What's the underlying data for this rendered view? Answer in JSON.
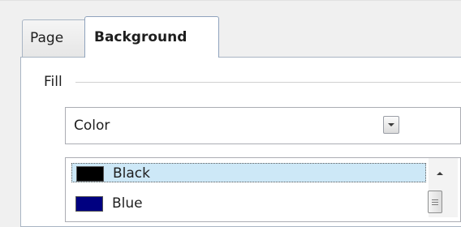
{
  "tabs": [
    {
      "label": "Page",
      "selected": false
    },
    {
      "label": "Background",
      "selected": true
    }
  ],
  "fill_group": {
    "label": "Fill",
    "fill_type": {
      "value": "Color"
    },
    "colors": [
      {
        "name": "Black",
        "swatch": "#000000",
        "selected": true
      },
      {
        "name": "Blue",
        "swatch": "#000080",
        "selected": false
      }
    ]
  },
  "icons": {
    "dropdown": "chevron-down-icon",
    "scroll_up": "scroll-up-arrow-icon",
    "scroll_thumb": "scroll-thumb-grip-icon"
  },
  "colors": {
    "selection_background": "#cde8f7",
    "border": "#a9b5c4"
  }
}
